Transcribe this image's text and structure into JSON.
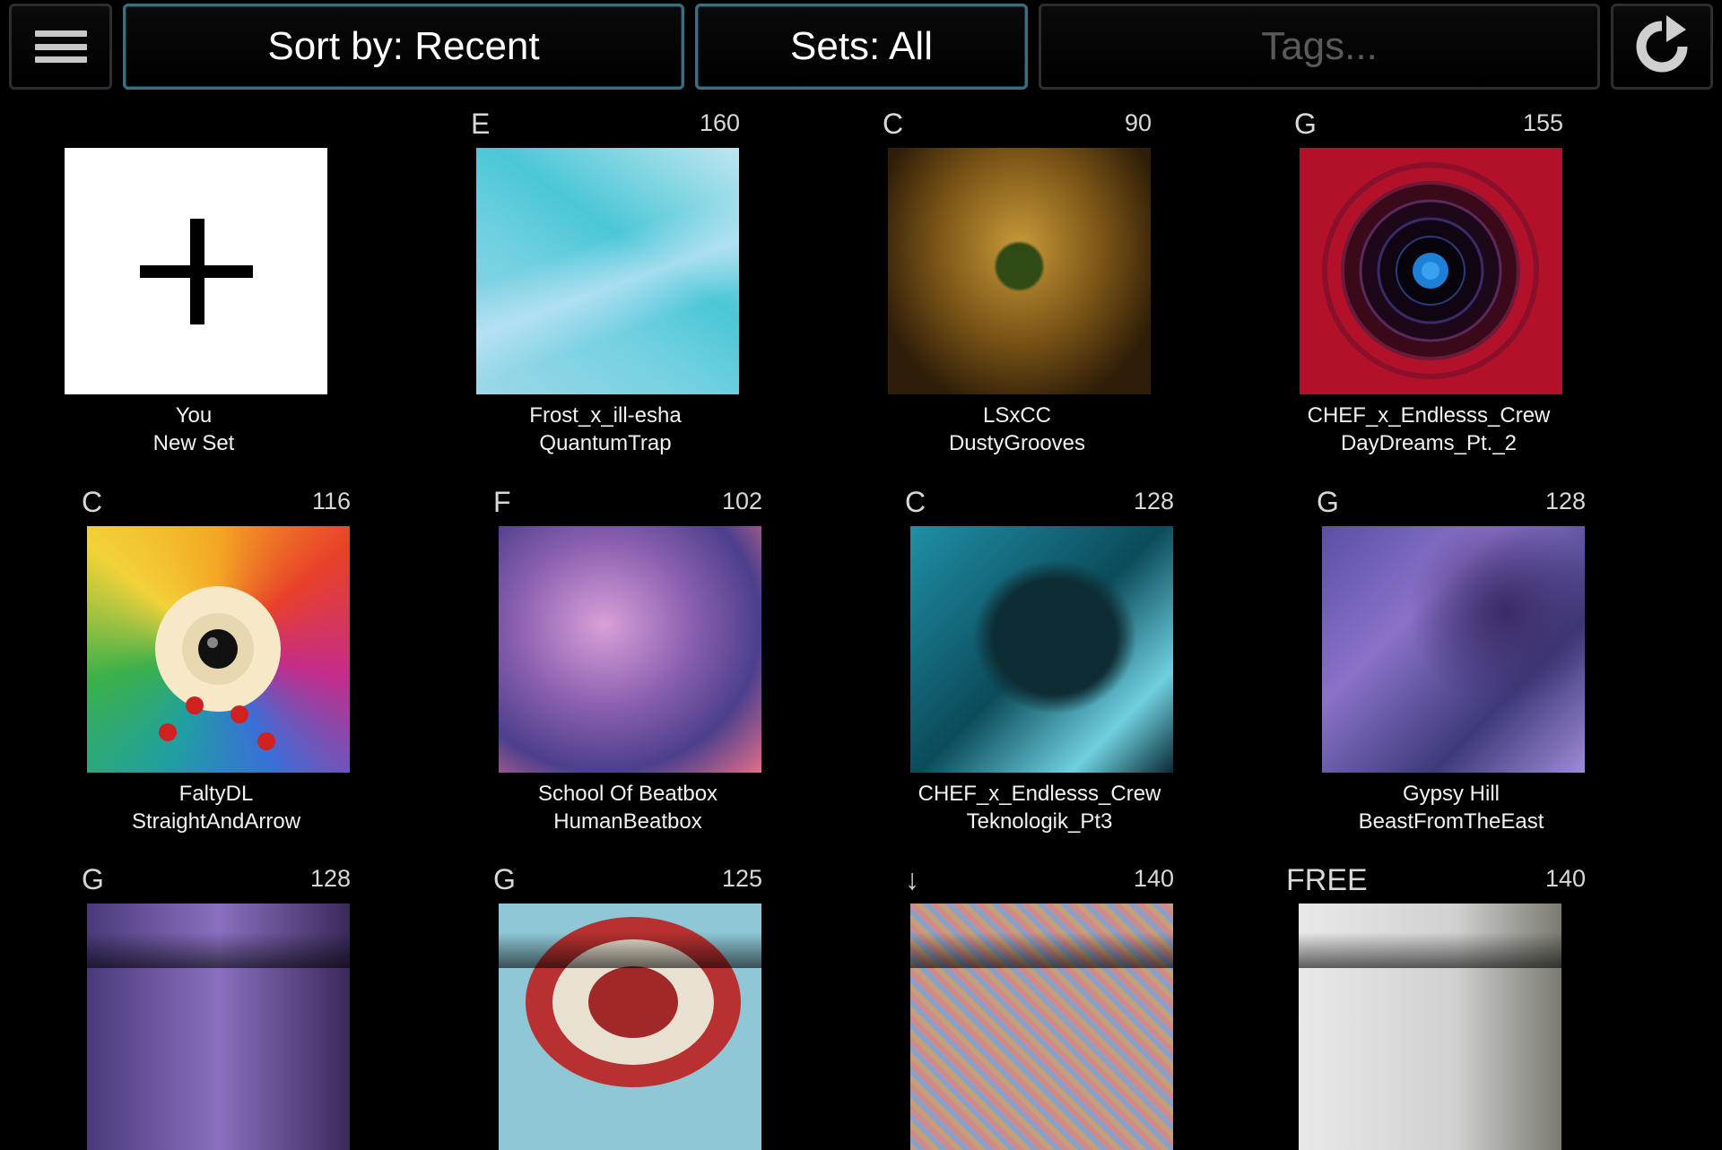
{
  "toolbar": {
    "sort_label": "Sort by: Recent",
    "sets_label": "Sets: All",
    "tags_placeholder": "Tags...",
    "menu_icon": "hamburger-menu-icon",
    "refresh_icon": "refresh-icon"
  },
  "cards": [
    {
      "key": "",
      "bpm": "",
      "line1": "You",
      "line2": "New Set",
      "art": "plus-icon"
    },
    {
      "key": "E",
      "bpm": "160",
      "line1": "Frost_x_ill-esha",
      "line2": "QuantumTrap"
    },
    {
      "key": "C",
      "bpm": "90",
      "line1": "LSxCC",
      "line2": "DustyGrooves"
    },
    {
      "key": "G",
      "bpm": "155",
      "line1": "CHEF_x_Endlesss_Crew",
      "line2": "DayDreams_Pt._2"
    },
    {
      "key": "C",
      "bpm": "116",
      "line1": "FaltyDL",
      "line2": "StraightAndArrow"
    },
    {
      "key": "F",
      "bpm": "102",
      "line1": "School Of Beatbox",
      "line2": "HumanBeatbox"
    },
    {
      "key": "C",
      "bpm": "128",
      "line1": "CHEF_x_Endlesss_Crew",
      "line2": "Teknologik_Pt3"
    },
    {
      "key": "G",
      "bpm": "128",
      "line1": "Gypsy Hill",
      "line2": "BeastFromTheEast"
    },
    {
      "key": "G",
      "bpm": "128",
      "line1": "",
      "line2": ""
    },
    {
      "key": "G",
      "bpm": "125",
      "line1": "",
      "line2": ""
    },
    {
      "key": "↓",
      "bpm": "140",
      "line1": "",
      "line2": ""
    },
    {
      "key": "FREE",
      "bpm": "140",
      "line1": "",
      "line2": ""
    }
  ],
  "colors": {
    "background": "#000000",
    "button_border_accent": "#3b6f7f",
    "button_border": "#2a2f33",
    "placeholder": "#5a5a5a"
  }
}
